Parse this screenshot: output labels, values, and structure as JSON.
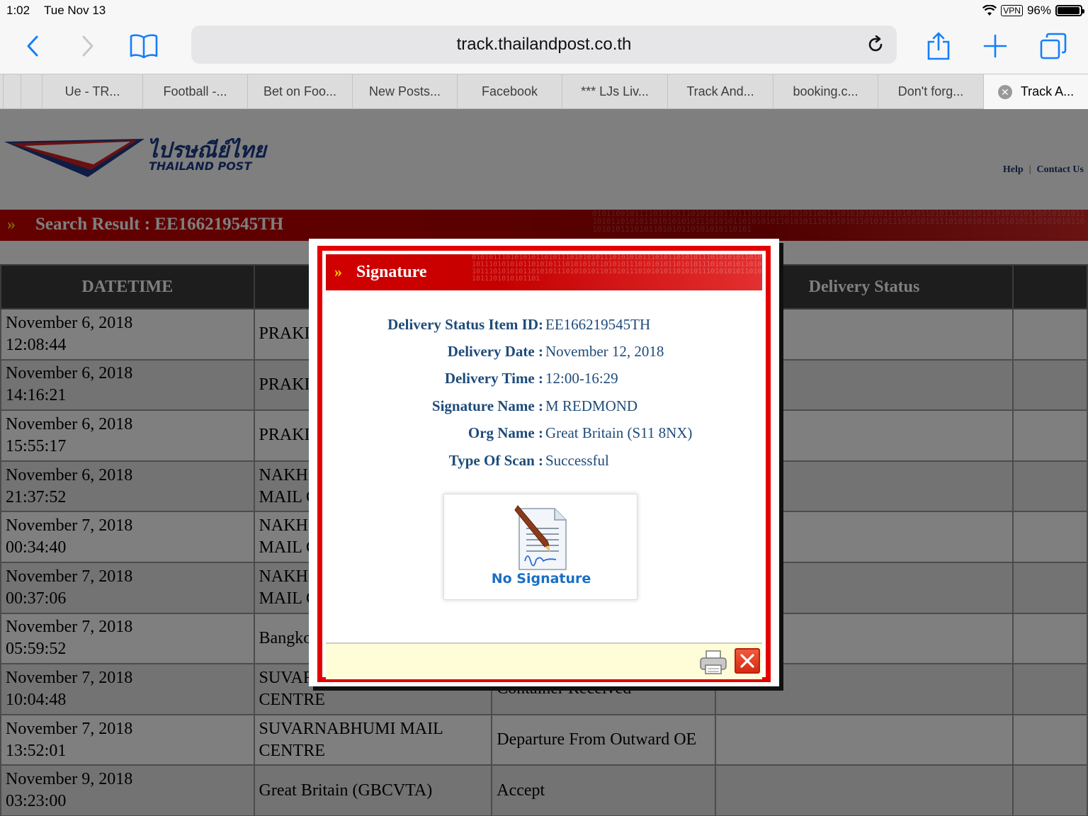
{
  "status_bar": {
    "time": "1:02",
    "date": "Tue Nov 13",
    "vpn": "VPN",
    "battery": "96%"
  },
  "browser": {
    "url": "track.thailandpost.co.th",
    "icons": [
      "back-icon",
      "forward-icon",
      "bookmarks-icon",
      "reload-icon",
      "share-icon",
      "new-tab-icon",
      "tabs-icon"
    ]
  },
  "tabs": [
    {
      "label": "Ue - TR..."
    },
    {
      "label": "Football -..."
    },
    {
      "label": "Bet on Foo..."
    },
    {
      "label": "New Posts..."
    },
    {
      "label": "Facebook"
    },
    {
      "label": "*** LJs Liv..."
    },
    {
      "label": "Track And..."
    },
    {
      "label": "booking.c..."
    },
    {
      "label": "Don't forg..."
    },
    {
      "label": "Track A...",
      "active": true
    }
  ],
  "site": {
    "logo_thai": "ไปรษณีย์ไทย",
    "logo_english": "THAILAND POST",
    "help_link": "Help",
    "contact_link": "Contact Us",
    "search_result_title": "Search Result : EE166219545TH"
  },
  "results_table": {
    "headers": [
      "DATETIME",
      "",
      "",
      "Delivery Status",
      ""
    ],
    "rows": [
      {
        "date": "November 6, 2018",
        "time": "12:08:44",
        "loc1": "PRAKI",
        "loc2": "",
        "status": ""
      },
      {
        "date": "November 6, 2018",
        "time": "14:16:21",
        "loc1": "PRAKI",
        "loc2": "",
        "status": ""
      },
      {
        "date": "November 6, 2018",
        "time": "15:55:17",
        "loc1": "PRAKI",
        "loc2": "",
        "status": ""
      },
      {
        "date": "November 6, 2018",
        "time": "21:37:52",
        "loc1": "NAKHO",
        "loc2": "MAIL C",
        "status": ""
      },
      {
        "date": "November 7, 2018",
        "time": "00:34:40",
        "loc1": "NAKHO",
        "loc2": "MAIL C",
        "status": ""
      },
      {
        "date": "November 7, 2018",
        "time": "00:37:06",
        "loc1": "NAKHO",
        "loc2": "MAIL C",
        "status": ""
      },
      {
        "date": "November 7, 2018",
        "time": "05:59:52",
        "loc1": "Bangko",
        "loc2": "",
        "status": ""
      },
      {
        "date": "November 7, 2018",
        "time": "10:04:48",
        "loc1": "SUVAR",
        "loc2": "CENTRE",
        "status": "Container Received"
      },
      {
        "date": "November 7, 2018",
        "time": "13:52:01",
        "loc1": "SUVARNABHUMI MAIL",
        "loc2": "CENTRE",
        "status": "Departure From Outward OE"
      },
      {
        "date": "November 9, 2018",
        "time": "03:23:00",
        "loc1": "Great Britain (GBCVTA)",
        "loc2": "",
        "status": "Accept"
      }
    ]
  },
  "modal": {
    "title": "Signature",
    "fields": [
      {
        "label": "Delivery Status Item ID:",
        "value": "EE166219545TH"
      },
      {
        "label": "Delivery Date :",
        "value": "November 12, 2018"
      },
      {
        "label": "Delivery Time :",
        "value": "12:00-16:29"
      },
      {
        "label": "Signature Name :",
        "value": "M REDMOND"
      },
      {
        "label": "Org Name :",
        "value": "Great Britain (S11 8NX)"
      },
      {
        "label": "Type Of Scan :",
        "value": "Successful"
      }
    ],
    "signature_text": "No Signature"
  },
  "colors": {
    "brand_red": "#e30000",
    "label_blue": "#1e4b7a",
    "footer_yellow": "#fffcd8",
    "no_signature_blue": "#1a6fc4"
  }
}
